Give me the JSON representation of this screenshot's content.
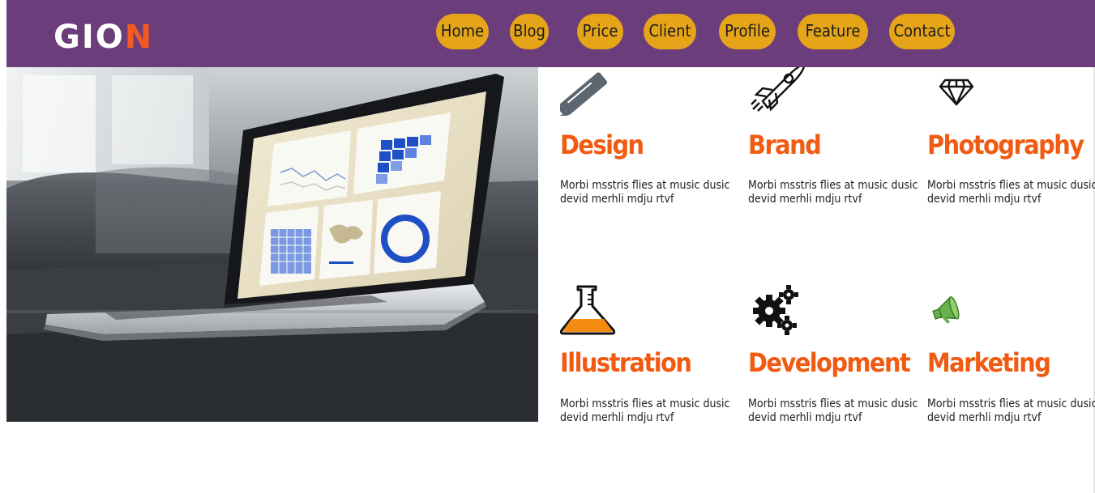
{
  "brand": {
    "logo_main": "GIO",
    "logo_accent": "N",
    "accent_color": "#f15a24",
    "header_bg": "#6b3d7a"
  },
  "nav": {
    "button_color": "#e6a519",
    "items": [
      {
        "label": "Home"
      },
      {
        "label": "Blog"
      },
      {
        "label": "Price"
      },
      {
        "label": "Client"
      },
      {
        "label": "Profile"
      },
      {
        "label": "Feature"
      },
      {
        "label": "Contact"
      }
    ]
  },
  "hero": {
    "icon": "laptop-dashboard-photo"
  },
  "services": {
    "title_color": "#f15a11",
    "items": [
      {
        "title": "Design",
        "icon": "pencil-icon",
        "description": "Morbi msstris flies at music dusic devid merhli mdju rtvf"
      },
      {
        "title": "Brand",
        "icon": "rocket-icon",
        "description": "Morbi msstris flies at music dusic devid merhli mdju rtvf"
      },
      {
        "title": "Photography",
        "icon": "diamond-icon",
        "description": "Morbi msstris flies at music dusic devid merhli mdju rtvf"
      },
      {
        "title": "Illustration",
        "icon": "flask-icon",
        "description": "Morbi msstris flies at music dusic devid merhli mdju rtvf"
      },
      {
        "title": "Development",
        "icon": "gears-icon",
        "description": "Morbi msstris flies at music dusic devid merhli mdju rtvf"
      },
      {
        "title": "Marketing",
        "icon": "megaphone-icon",
        "description": "Morbi msstris flies at music dusic devid merhli mdju rtvf"
      }
    ]
  }
}
